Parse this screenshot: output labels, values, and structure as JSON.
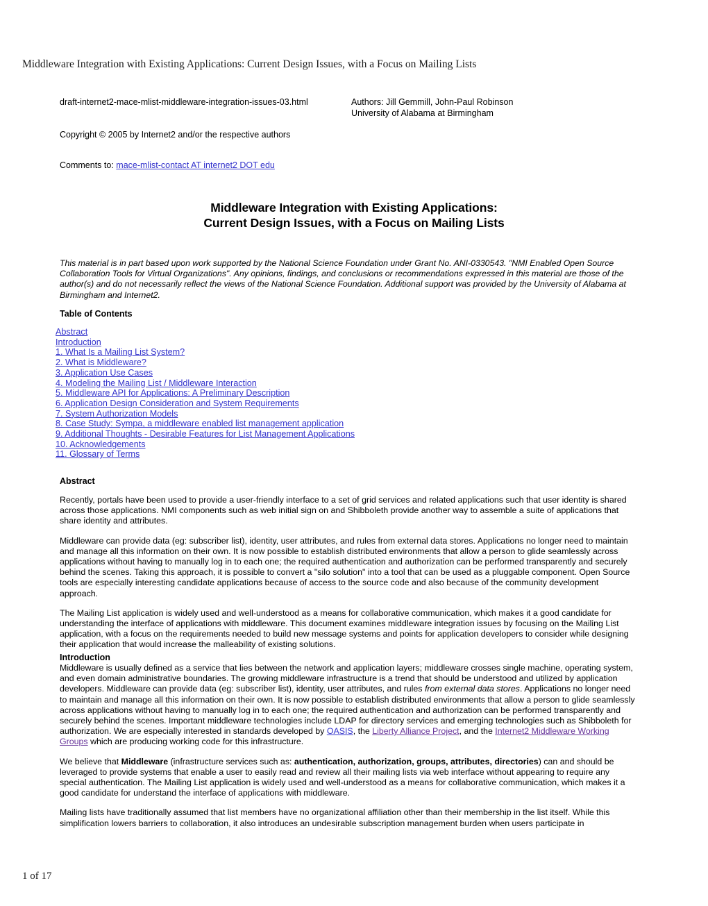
{
  "running_header": "Middleware Integration with Existing Applications: Current Design Issues, with a Focus on Mailing Lists",
  "meta": {
    "filename": "draft-internet2-mace-mlist-middleware-integration-issues-03.html",
    "authors_line": "Authors: Jill Gemmill, John-Paul Robinson",
    "affiliation_line": "University of Alabama at Birmingham",
    "copyright": "Copyright © 2005 by Internet2 and/or the respective authors",
    "comments_label": "Comments to:",
    "comments_link": "mace-mlist-contact AT internet2 DOT edu"
  },
  "doc_title": {
    "line1": "Middleware Integration with Existing Applications:",
    "line2": "Current Design Issues, with a Focus on Mailing Lists"
  },
  "funding_note": "This material is in part based upon work supported by the National Science Foundation under Grant No. ANI-0330543. \"NMI Enabled Open Source Collaboration Tools for Virtual Organizations\". Any opinions, findings, and conclusions or recommendations expressed in this material are those of the author(s) and do not necessarily reflect the views of the National Science Foundation. Additional support was provided by the University of Alabama at Birmingham and Internet2.",
  "toc": {
    "heading": "Table of Contents",
    "items": [
      "Abstract",
      "Introduction",
      "1. What Is a Mailing List System?",
      "2. What is Middleware?",
      "3. Application Use Cases",
      "4. Modeling the Mailing List / Middleware Interaction",
      "5. Middleware API for Applications: A Preliminary Description",
      "6. Application Design Consideration and System Requirements",
      "7. System Authorization Models",
      "8. Case Study: Sympa, a middleware enabled list management application",
      "9. Additional Thoughts - Desirable Features for List Management Applications",
      "10. Acknowledgements",
      "11. Glossary of Terms"
    ]
  },
  "abstract": {
    "heading": "Abstract",
    "p1": "Recently, portals have been used to provide a user-friendly interface to a set of grid services and related applications such that user identity is shared across those applications. NMI components such as web initial sign on and Shibboleth provide another way to assemble a suite of applications that share identity and attributes.",
    "p2": "Middleware can provide data (eg: subscriber list), identity, user attributes, and rules from external data stores. Applications no longer need to maintain and manage all this information on their own. It is now possible to establish distributed environments that allow a person to glide seamlessly across applications without having to manually log in to each one; the required authentication and authorization can be performed transparently and securely behind the scenes. Taking this approach, it is possible to convert a \"silo solution\" into a tool that can be used as a pluggable component. Open Source tools are especially interesting candidate applications because of access to the source code and also because of the community development approach.",
    "p3": "The Mailing List application is widely used and well-understood as a means for collaborative communication, which makes it a good candidate for understanding the interface of applications with middleware. This document examines middleware integration issues by focusing on the Mailing List application, with a focus on the requirements needed to build new message systems and points for application developers to consider while designing their application that would increase the malleability of existing solutions."
  },
  "introduction": {
    "heading": "Introduction",
    "p1_a": "Middleware is usually defined as a service that lies between the network and application layers; middleware crosses single machine, operating system, and even domain administrative boundaries. The growing middleware infrastructure is a trend that should be understood and utilized by application developers. Middleware can provide data (eg: subscriber list), identity, user attributes, and rules ",
    "p1_em": "from external data stores",
    "p1_b": ". Applications no longer need to maintain and manage all this information on their own. It is now possible to establish distributed environments that allow a person to glide seamlessly across applications without having to manually log in to each one; the required authentication and authorization can be performed transparently and securely behind the scenes. Important middleware technologies include LDAP for directory services and emerging technologies such as Shibboleth for authorization. We are especially interested in standards developed by ",
    "p1_link_oasis": "OASIS",
    "p1_c": ", the ",
    "p1_link_liberty": "Liberty Alliance Project",
    "p1_d": ", and the ",
    "p1_link_i2": "Internet2 Middleware Working Groups",
    "p1_e": " which are producing working code for this infrastructure.",
    "p2_a": "We believe that ",
    "p2_strong1": "Middleware",
    "p2_b": " (infrastructure services such as: ",
    "p2_strong2": "authentication, authorization, groups, attributes, directories",
    "p2_c": ") can and should be leveraged to provide systems that enable a user to easily read and review all their mailing lists via web interface without appearing to require any special authentication. The Mailing List application is widely used and well-understood as a means for collaborative communication, which makes it a good candidate for understand the interface of applications with middleware.",
    "p3": "Mailing lists have traditionally assumed that list members have no organizational affiliation other than their membership in the list itself. While this simplification lowers barriers to collaboration, it also introduces an undesirable subscription management burden when users participate in"
  },
  "footer": {
    "page_indicator": "1 of 17"
  },
  "colors": {
    "link": "#3333cc",
    "visited_link": "#663399",
    "text": "#000000",
    "background": "#ffffff"
  }
}
